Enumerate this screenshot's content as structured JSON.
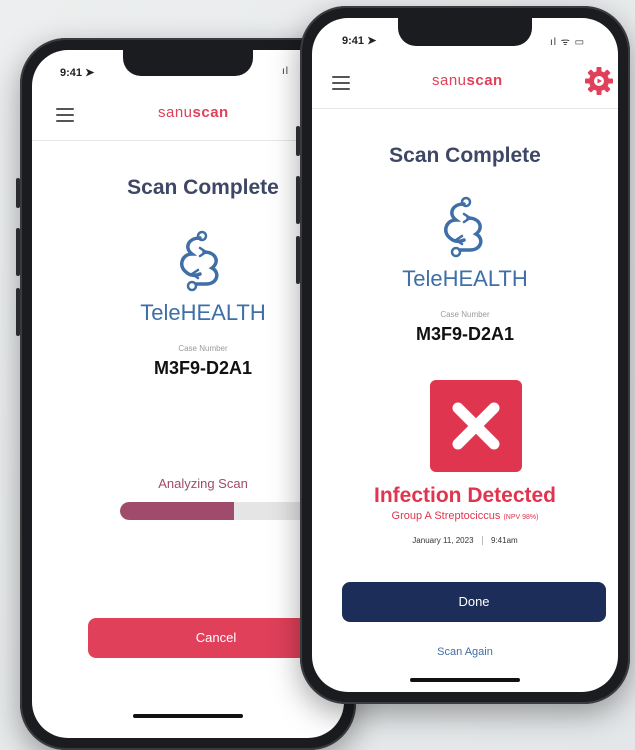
{
  "phone_back": {
    "status_time": "9:41 ➤",
    "status_icons": "ıl",
    "logo_prefix": "sanu",
    "logo_suffix": "scan",
    "title": "Scan Complete",
    "brand": "TeleHEALTH",
    "case_label": "Case Number",
    "case_number": "M3F9-D2A1",
    "analyzing_label": "Analyzing Scan",
    "progress": 0.57,
    "cancel_label": "Cancel"
  },
  "phone_front": {
    "status_time": "9:41 ➤",
    "status_icons": "ıl ᯤ ▭",
    "logo_prefix": "sanu",
    "logo_suffix": "scan",
    "title": "Scan Complete",
    "brand": "TeleHEALTH",
    "case_label": "Case Number",
    "case_number": "M3F9-D2A1",
    "result_title": "Infection Detected",
    "result_detail": "Group A Streptociccus",
    "result_npv": "(NPV 98%)",
    "date": "January 11, 2023",
    "time": "9:41am",
    "done_label": "Done",
    "scan_again_label": "Scan Again"
  },
  "colors": {
    "accent_red": "#e0405a",
    "navy": "#1d2d59",
    "progress_fill": "#a14b6c",
    "brand_blue": "#3f6fa6"
  },
  "icons": [
    "menu-icon",
    "settings-gear-icon",
    "telehealth-logo-icon",
    "x-mark-icon"
  ]
}
